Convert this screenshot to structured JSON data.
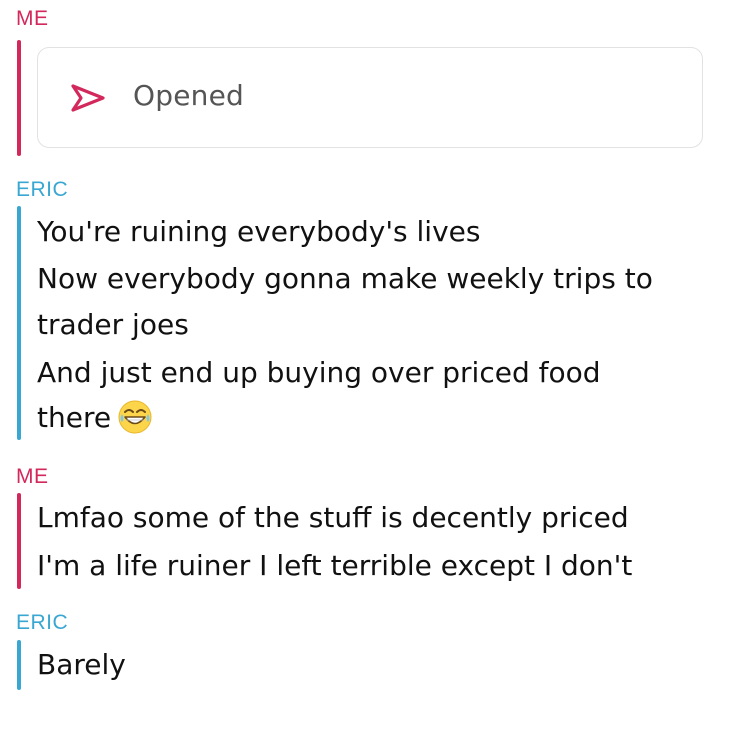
{
  "thread": [
    {
      "sender": "ME",
      "type": "status",
      "status_text": "Opened",
      "icon": "sent-arrow-icon"
    },
    {
      "sender": "ERIC",
      "type": "messages",
      "lines": [
        "You're ruining everybody's lives",
        "Now everybody gonna make weekly trips to",
        "trader joes",
        "And just end up buying over priced food",
        "there"
      ],
      "emoji": "tears-of-joy-emoji"
    },
    {
      "sender": "ME",
      "type": "messages",
      "lines": [
        "Lmfao some of the stuff is decently priced",
        "I'm a life ruiner I left terrible except I don't"
      ]
    },
    {
      "sender": "ERIC",
      "type": "messages",
      "lines": [
        "Barely"
      ]
    }
  ],
  "colors": {
    "me": "#d3285b",
    "eric": "#3aa7d2",
    "status_text": "#555555",
    "card_border": "#e2e2e2"
  }
}
